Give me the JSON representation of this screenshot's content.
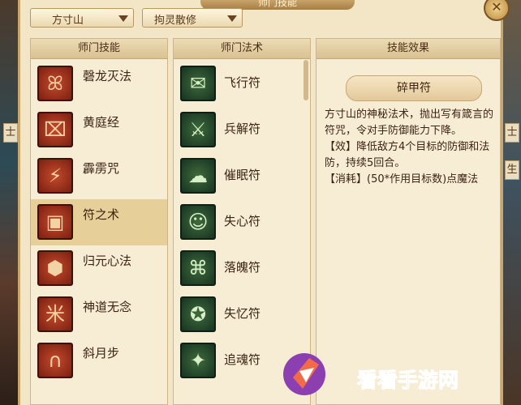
{
  "window": {
    "title": "师门技能",
    "close_icon": "close-icon"
  },
  "side_tabs": [
    "士",
    "士",
    "生"
  ],
  "dropdowns": [
    {
      "label": "方寸山",
      "icon": "chevron-down-icon"
    },
    {
      "label": "拘灵散修",
      "icon": "chevron-down-icon"
    }
  ],
  "skills_panel": {
    "header": "师门技能",
    "items": [
      {
        "label": "磬龙灭法",
        "glyph": "ꕤ"
      },
      {
        "label": "黄庭经",
        "glyph": "⌧"
      },
      {
        "label": "霹雳咒",
        "glyph": "⚡"
      },
      {
        "label": "符之术",
        "glyph": "▣"
      },
      {
        "label": "归元心法",
        "glyph": "⬢"
      },
      {
        "label": "神道无念",
        "glyph": "米"
      },
      {
        "label": "斜月步",
        "glyph": "∩"
      }
    ],
    "selected": "符之术"
  },
  "spells_panel": {
    "header": "师门法术",
    "items": [
      {
        "label": "飞行符",
        "glyph": "✉"
      },
      {
        "label": "兵解符",
        "glyph": "⚔"
      },
      {
        "label": "催眠符",
        "glyph": "☁"
      },
      {
        "label": "失心符",
        "glyph": "☺"
      },
      {
        "label": "落魄符",
        "glyph": "⌘"
      },
      {
        "label": "失忆符",
        "glyph": "✪"
      },
      {
        "label": "追魂符",
        "glyph": "✦"
      }
    ]
  },
  "effect_panel": {
    "header": "技能效果",
    "spell_name": "碎甲符",
    "description": "方寸山的神秘法术，抛出写有箴言的符咒，令对手防御能力下降。",
    "effect": "【效】降低敌方4个目标的防御和法防，持续5回合。",
    "cost": "【消耗】(50*作用目标数)点魔法"
  },
  "watermark": {
    "text": "看看手游网"
  }
}
